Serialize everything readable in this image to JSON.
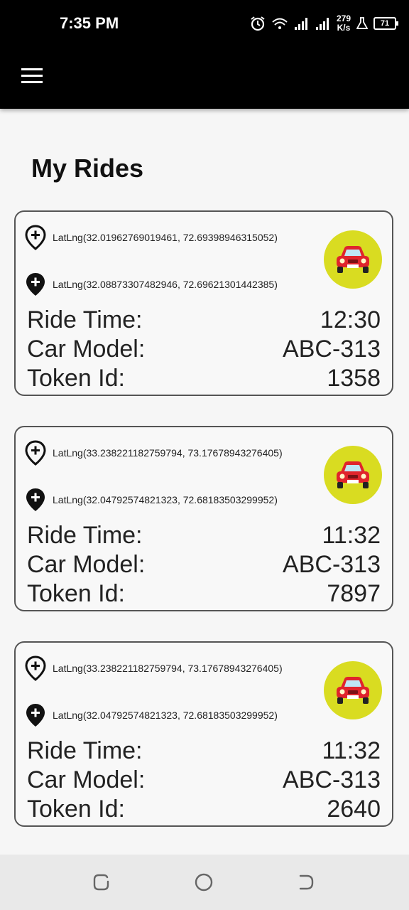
{
  "status_bar": {
    "time": "7:35 PM",
    "net_speed_value": "279",
    "net_speed_unit": "K/s",
    "battery": "71"
  },
  "page": {
    "title": "My Rides"
  },
  "labels": {
    "ride_time": "Ride Time:",
    "car_model": "Car Model:",
    "token_id": "Token Id:"
  },
  "rides": [
    {
      "from": "LatLng(32.01962769019461, 72.69398946315052)",
      "to": "LatLng(32.08873307482946, 72.69621301442385)",
      "ride_time": "12:30",
      "car_model": "ABC-313",
      "token_id": "1358"
    },
    {
      "from": "LatLng(33.238221182759794, 73.17678943276405)",
      "to": "LatLng(32.04792574821323, 72.68183503299952)",
      "ride_time": "11:32",
      "car_model": "ABC-313",
      "token_id": "7897"
    },
    {
      "from": "LatLng(33.238221182759794, 73.17678943276405)",
      "to": "LatLng(32.04792574821323, 72.68183503299952)",
      "ride_time": "11:32",
      "car_model": "ABC-313",
      "token_id": "2640"
    }
  ],
  "icons": {
    "menu": "hamburger-menu-icon",
    "from_pin": "add-location-outline-icon",
    "to_pin": "add-location-filled-icon",
    "car": "car-icon"
  },
  "colors": {
    "appbar": "#000000",
    "car_circle": "#d9dc21",
    "car": "#e0242c"
  }
}
